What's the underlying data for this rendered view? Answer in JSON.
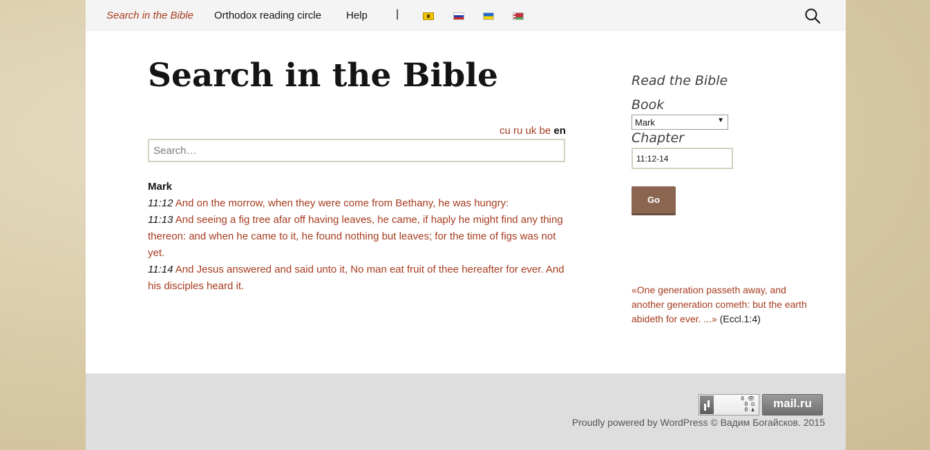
{
  "nav": {
    "items": [
      {
        "label": "Search in the Bible",
        "active": true
      },
      {
        "label": "Orthodox reading circle",
        "active": false
      },
      {
        "label": "Help",
        "active": false
      }
    ],
    "separator": "|",
    "flags": [
      "cu",
      "ru",
      "uk",
      "be"
    ],
    "search_icon": "search-icon"
  },
  "main": {
    "title": "Search in the Bible",
    "languages": [
      "cu",
      "ru",
      "uk",
      "be"
    ],
    "current_language": "en",
    "search": {
      "placeholder": "Search…",
      "value": ""
    },
    "book": "Mark",
    "verses": [
      {
        "ref": "11:12",
        "text": "And on the morrow, when they were come from Bethany, he was hungry:"
      },
      {
        "ref": "11:13",
        "text": "And seeing a fig tree afar off having leaves, he came, if haply he might find any thing thereon: and when he came to it, he found nothing but leaves; for the time of figs was not yet."
      },
      {
        "ref": "11:14",
        "text": "And Jesus answered and said unto it, No man eat fruit of thee hereafter for ever. And his disciples heard it."
      }
    ]
  },
  "sidebar": {
    "heading": "Read the Bible",
    "book_label": "Book",
    "book_value": "Mark",
    "chapter_label": "Chapter",
    "chapter_value": "11:12-14",
    "go_label": "Go",
    "quote": "«One generation passeth away, and another generation cometh: but the earth abideth for ever. ...»",
    "quote_source": "(Eccl.1:4)"
  },
  "footer": {
    "counter_stats": "0 👁\n0 ⊟\n0 ♟",
    "mailru": "mail.ru",
    "powered": "Proudly powered by WordPress © Вадим Богайсков. 2015"
  },
  "colors": {
    "link": "#a63b1e",
    "button": "#8a6650",
    "nav_bg": "#f4f4f4",
    "footer_bg": "#dedede"
  }
}
